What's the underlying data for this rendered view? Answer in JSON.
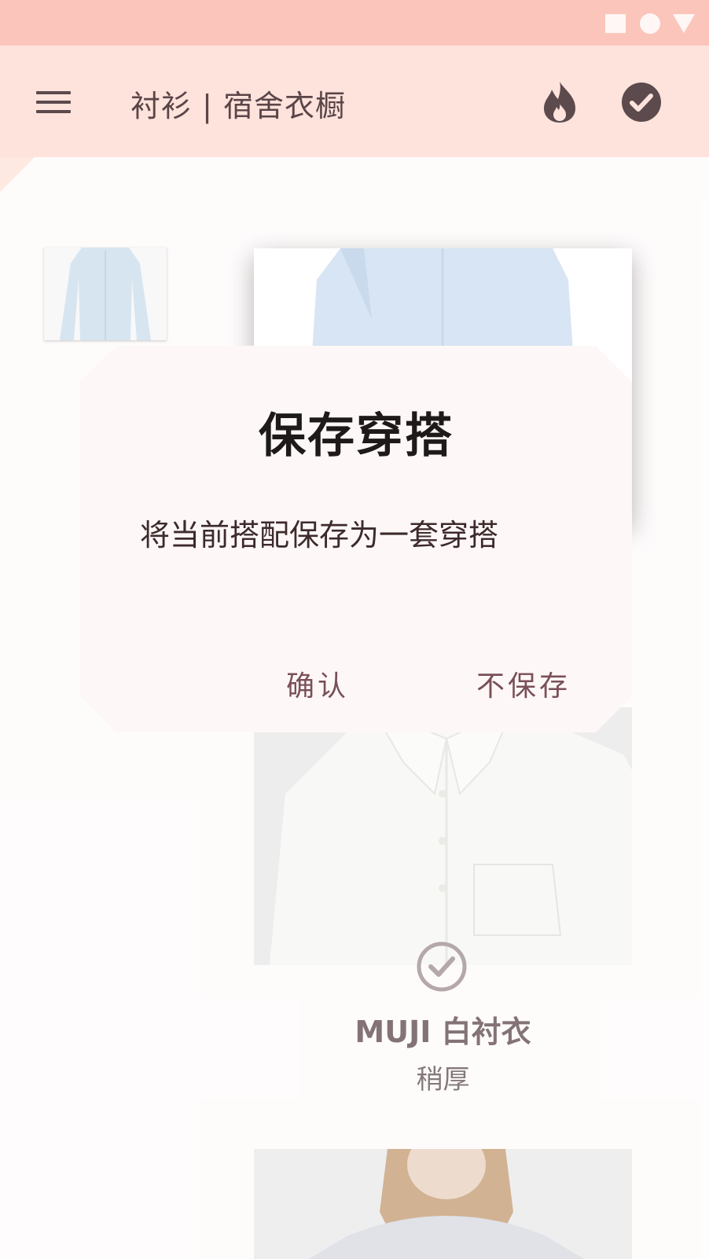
{
  "app_bar": {
    "title": "衬衫 | 宿舍衣橱",
    "menu_icon": "hamburger-menu-icon",
    "actions": [
      "fire-icon",
      "check-circle-icon"
    ]
  },
  "colors": {
    "status_bar": "#fbc5bc",
    "app_bar": "#fee3dc",
    "accent_text": "#7a4f58",
    "dialog_bg": "#fdf8f7"
  },
  "items": [
    {
      "title": "MUJI 白衬衣",
      "subtitle": "稍厚",
      "selected": true
    }
  ],
  "dialog": {
    "title": "保存穿搭",
    "message": "将当前搭配保存为一套穿搭",
    "confirm_label": "确认",
    "dismiss_label": "不保存"
  }
}
